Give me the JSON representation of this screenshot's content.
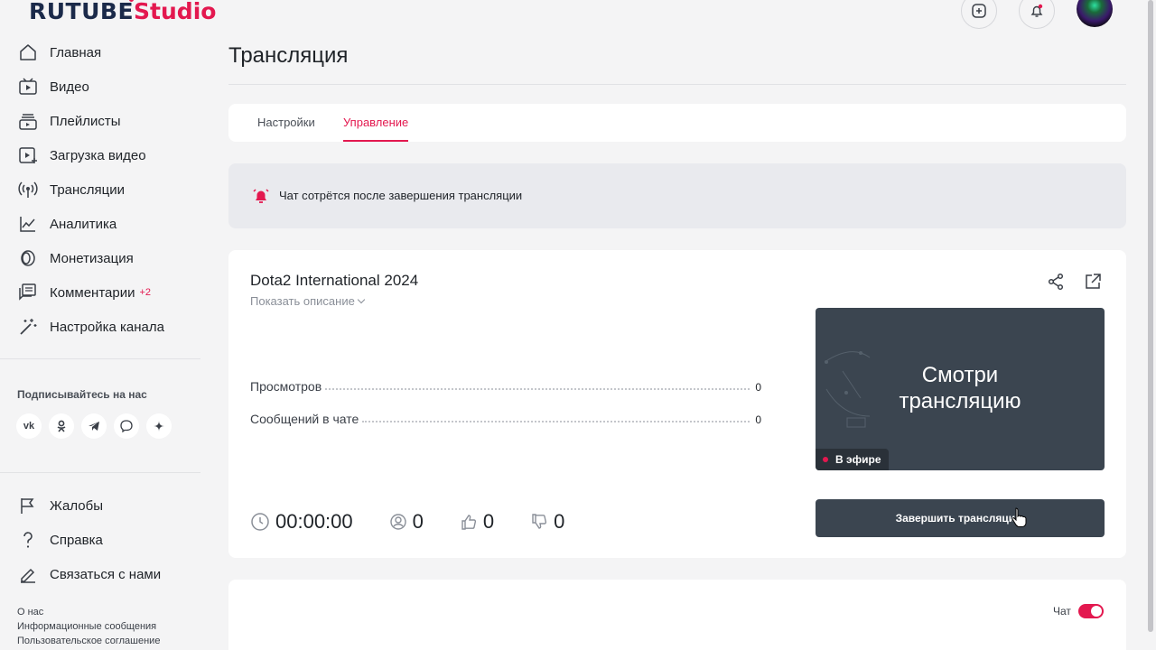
{
  "header": {
    "logo_main": "RUTUBE",
    "logo_studio": "Studio"
  },
  "sidebar": {
    "items": [
      {
        "label": "Главная",
        "icon": "home-icon"
      },
      {
        "label": "Видео",
        "icon": "video-icon"
      },
      {
        "label": "Плейлисты",
        "icon": "playlist-icon"
      },
      {
        "label": "Загрузка видео",
        "icon": "upload-icon"
      },
      {
        "label": "Трансляции",
        "icon": "broadcast-icon"
      },
      {
        "label": "Аналитика",
        "icon": "analytics-icon"
      },
      {
        "label": "Монетизация",
        "icon": "monetization-icon"
      },
      {
        "label": "Комментарии",
        "icon": "comments-icon",
        "badge": "+2"
      },
      {
        "label": "Настройка канала",
        "icon": "magic-wand-icon"
      }
    ],
    "follow_title": "Подписывайтесь на нас",
    "socials": [
      "vk",
      "ok",
      "telegram",
      "viber",
      "zen"
    ],
    "bottom_items": [
      {
        "label": "Жалобы",
        "icon": "flag-icon"
      },
      {
        "label": "Справка",
        "icon": "help-icon"
      },
      {
        "label": "Связаться с нами",
        "icon": "edit-icon"
      }
    ],
    "footer_links": [
      "О нас",
      "Информационные сообщения",
      "Пользовательское соглашение"
    ]
  },
  "main": {
    "title": "Трансляция",
    "tabs": [
      {
        "label": "Настройки",
        "active": false
      },
      {
        "label": "Управление",
        "active": true
      }
    ],
    "notice": "Чат сотрётся после завершения трансляции",
    "stream": {
      "title": "Dota2 International 2024",
      "show_description": "Показать описание",
      "stats": [
        {
          "label": "Просмотров",
          "value": "0"
        },
        {
          "label": "Сообщений в чате",
          "value": "0"
        }
      ],
      "preview_text_line1": "Смотри",
      "preview_text_line2": "трансляцию",
      "live_badge": "В эфире",
      "end_button": "Завершить трансляцию",
      "timer": "00:00:00",
      "viewers": "0",
      "likes": "0",
      "dislikes": "0"
    },
    "chat_label": "Чат",
    "chat_enabled": true
  },
  "colors": {
    "accent": "#e3184f",
    "dark_button": "#3b4550",
    "background": "#f4f4f5"
  }
}
